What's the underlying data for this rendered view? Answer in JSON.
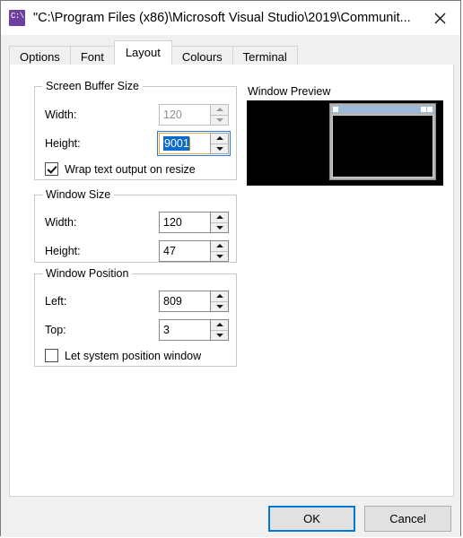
{
  "window": {
    "title": "\"C:\\Program Files (x86)\\Microsoft Visual Studio\\2019\\Communit...",
    "icon": "console-icon",
    "icon_glyph": "C:\\",
    "close_label": "close-icon"
  },
  "tabs": [
    {
      "label": "Options",
      "active": false
    },
    {
      "label": "Font",
      "active": false
    },
    {
      "label": "Layout",
      "active": true
    },
    {
      "label": "Colours",
      "active": false
    },
    {
      "label": "Terminal",
      "active": false
    }
  ],
  "groups": {
    "screen_buffer_size": {
      "title": "Screen Buffer Size",
      "width_label": "Width:",
      "width_value": "120",
      "width_disabled": true,
      "height_label": "Height:",
      "height_value": "9001",
      "height_focused": true,
      "wrap_label": "Wrap text output on resize",
      "wrap_checked": true
    },
    "window_size": {
      "title": "Window Size",
      "width_label": "Width:",
      "width_value": "120",
      "height_label": "Height:",
      "height_value": "47"
    },
    "window_position": {
      "title": "Window Position",
      "left_label": "Left:",
      "left_value": "809",
      "top_label": "Top:",
      "top_value": "3",
      "let_system_label": "Let system position window",
      "let_system_checked": false
    }
  },
  "preview": {
    "title": "Window Preview"
  },
  "footer": {
    "ok_label": "OK",
    "cancel_label": "Cancel"
  },
  "colors": {
    "accent": "#0078d7",
    "selection": "#0a6cd0",
    "focus_border": "#e8a33d",
    "titlebar_icon": "#6c3fa0",
    "preview_bg": "#000000",
    "mini_titlebar": "#9db9d9",
    "dialog_bg": "#f0f0f0"
  }
}
